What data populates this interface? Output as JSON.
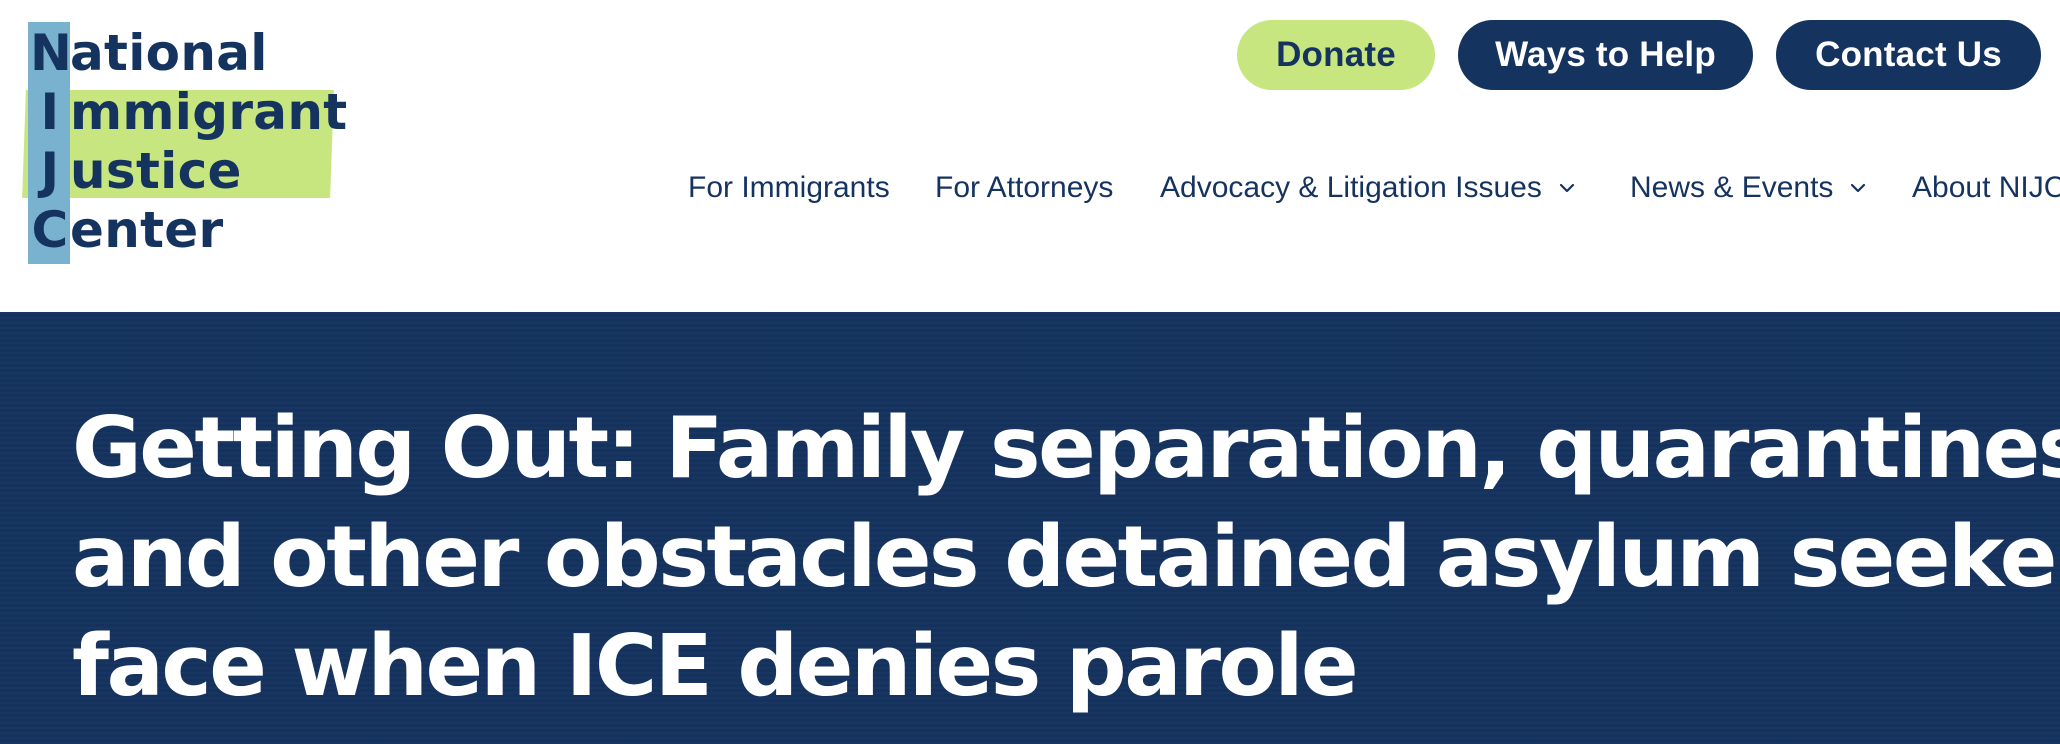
{
  "logo": {
    "lines": [
      {
        "initial": "N",
        "rest": "ational"
      },
      {
        "initial": "I",
        "rest": "mmigrant"
      },
      {
        "initial": "J",
        "rest": "ustice"
      },
      {
        "initial": "C",
        "rest": "enter"
      }
    ],
    "colors": {
      "text": "#15335f",
      "highlight": "#c8e67f",
      "stripe": "#79b2cf"
    }
  },
  "header_actions": {
    "donate": "Donate",
    "ways_to_help": "Ways to Help",
    "contact_us": "Contact Us"
  },
  "nav": {
    "items": [
      {
        "label": "For Immigrants",
        "has_dropdown": false
      },
      {
        "label": "For Attorneys",
        "has_dropdown": false
      },
      {
        "label": "Advocacy & Litigation Issues",
        "has_dropdown": true,
        "icon": "chevron-down-icon"
      },
      {
        "label": "News & Events",
        "has_dropdown": true,
        "icon": "chevron-down-icon"
      },
      {
        "label": "About NIJC",
        "has_dropdown": false
      }
    ]
  },
  "hero": {
    "title_lines": [
      "Getting Out: Family separation, quarantines,",
      "and other obstacles detained asylum seekers",
      "face when ICE denies parole"
    ]
  },
  "colors": {
    "navy": "#15335f",
    "lime": "#c8e67f",
    "white": "#ffffff"
  }
}
